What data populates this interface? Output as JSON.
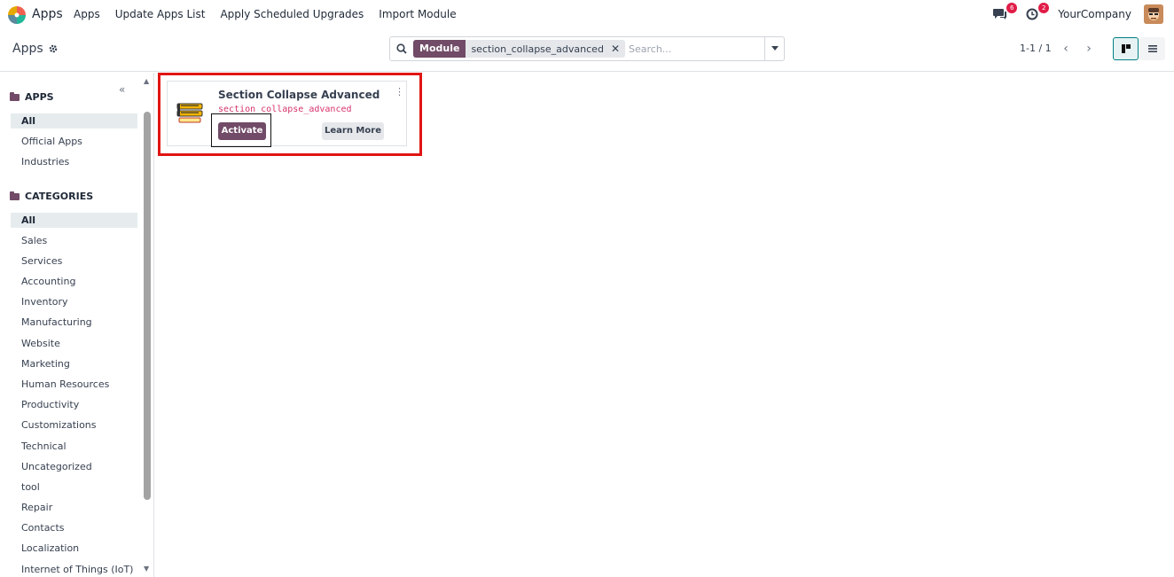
{
  "navbar": {
    "app_title": "Apps",
    "menu": [
      "Apps",
      "Update Apps List",
      "Apply Scheduled Upgrades",
      "Import Module"
    ],
    "messages_count": "6",
    "activities_count": "2",
    "company": "YourCompany"
  },
  "control": {
    "breadcrumb": "Apps",
    "facet_label": "Module",
    "facet_value": "section_collapse_advanced",
    "search_placeholder": "Search...",
    "pager": "1-1 / 1"
  },
  "sidebar": {
    "apps_header": "APPS",
    "apps_items": [
      "All",
      "Official Apps",
      "Industries"
    ],
    "categories_header": "CATEGORIES",
    "categories_items": [
      "All",
      "Sales",
      "Services",
      "Accounting",
      "Inventory",
      "Manufacturing",
      "Website",
      "Marketing",
      "Human Resources",
      "Productivity",
      "Customizations",
      "Technical",
      "Uncategorized",
      "tool",
      "Repair",
      "Contacts",
      "Localization",
      "Internet of Things (IoT)"
    ]
  },
  "card": {
    "title": "Section Collapse Advanced",
    "technical_name": "section_collapse_advanced",
    "activate_label": "Activate",
    "learn_more_label": "Learn More"
  },
  "colors": {
    "brand": "#714b67",
    "highlight": "#e11414",
    "technical_name": "#d6336c",
    "badge": "#e11d48"
  }
}
